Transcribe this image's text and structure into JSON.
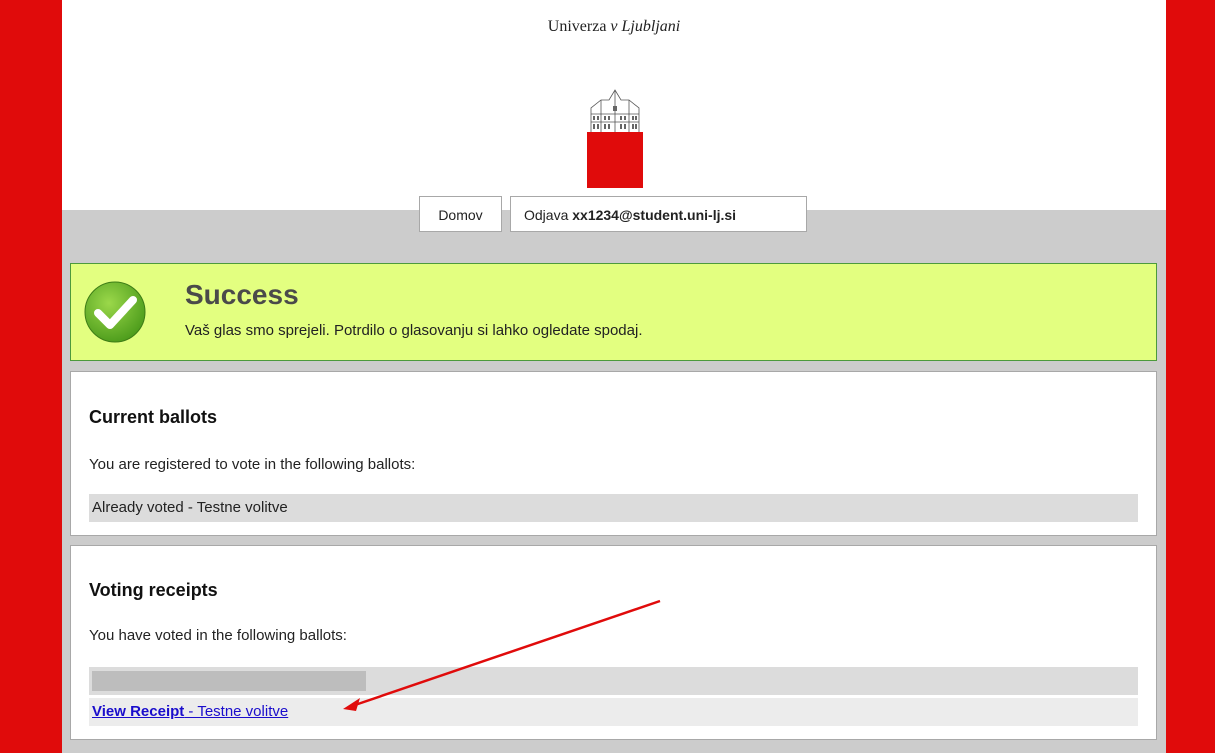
{
  "header": {
    "university_prefix": "Univerza",
    "university_italic": "v Ljubljani"
  },
  "nav": {
    "home_label": "Domov",
    "logout_prefix": "Odjava",
    "user_email": "xx1234@student.uni-lj.si"
  },
  "alert": {
    "title": "Success",
    "message": "Vaš glas smo sprejeli. Potrdilo o glasovanju si lahko ogledate spodaj.",
    "icon": "check-icon"
  },
  "current_ballots": {
    "heading": "Current ballots",
    "description": "You are registered to vote in the following ballots:",
    "items": [
      "Already voted - Testne volitve"
    ]
  },
  "voting_receipts": {
    "heading": "Voting receipts",
    "description": "You have voted in the following ballots:",
    "receipt_link_label": "View Receipt",
    "receipt_ballot": " - Testne volitve"
  },
  "colors": {
    "brand_red": "#e00b0b",
    "success_bg": "#e3ff80",
    "link_blue": "#1a0dcc"
  }
}
